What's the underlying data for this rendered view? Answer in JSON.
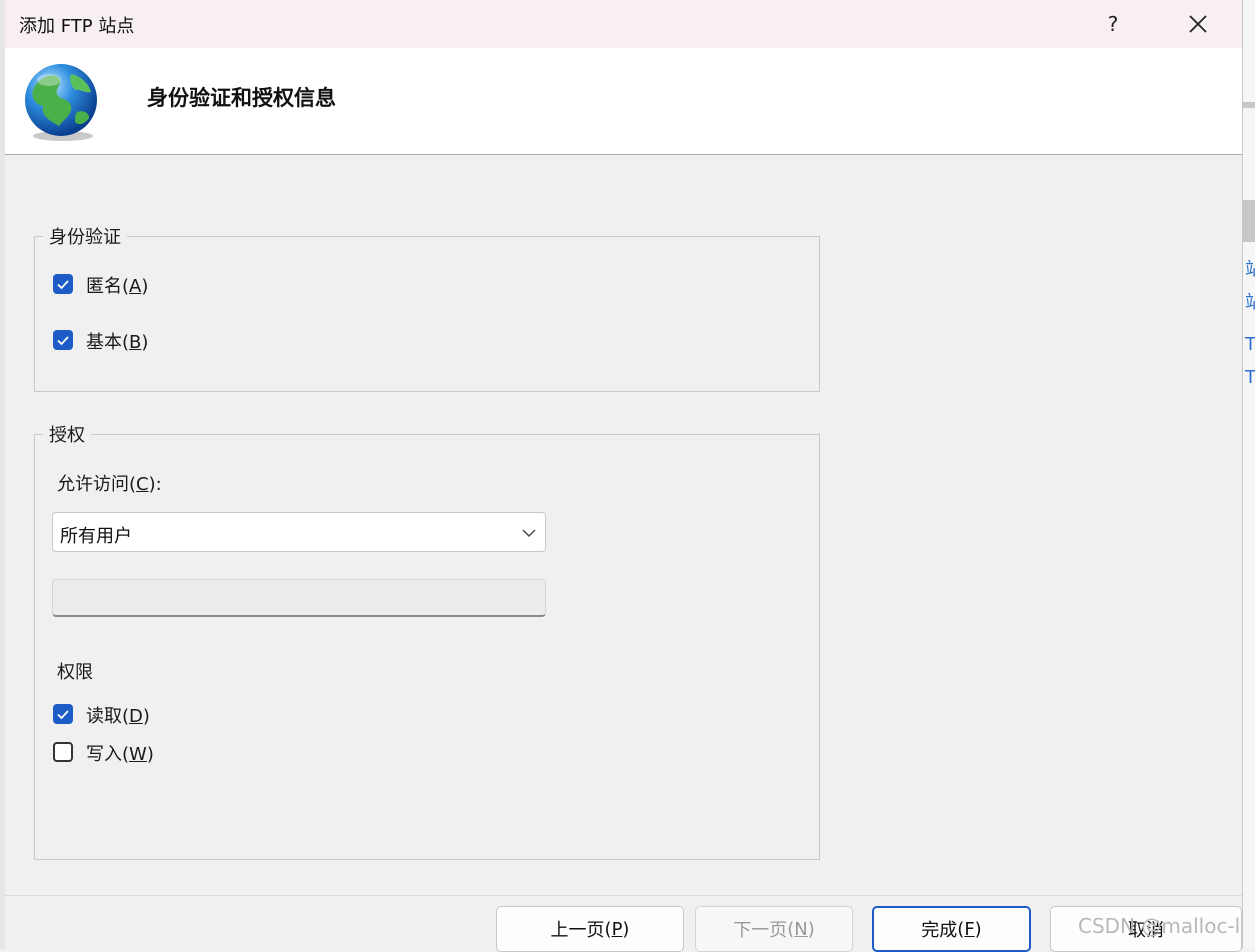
{
  "window": {
    "title": "添加 FTP 站点",
    "help_label": "?",
    "header_title": "身份验证和授权信息"
  },
  "authentication": {
    "legend": "身份验证",
    "anonymous": {
      "label": "匿名",
      "key": "A",
      "checked": true
    },
    "basic": {
      "label": "基本",
      "key": "B",
      "checked": true
    }
  },
  "authorization": {
    "legend": "授权",
    "allow_access": {
      "label": "允许访问",
      "key": "C",
      "suffix": ":",
      "selected": "所有用户"
    },
    "user_field_value": "",
    "permissions_label": "权限",
    "read": {
      "label": "读取",
      "key": "D",
      "checked": true
    },
    "write": {
      "label": "写入",
      "key": "W",
      "checked": false
    }
  },
  "buttons": {
    "previous": {
      "label": "上一页",
      "key": "P",
      "enabled": true
    },
    "next": {
      "label": "下一页",
      "key": "N",
      "enabled": false
    },
    "finish": {
      "label": "完成",
      "key": "F",
      "enabled": true
    },
    "cancel": {
      "label": "取消",
      "enabled": true
    }
  },
  "watermark": "CSDN @malloc-l",
  "background_window_fragments": [
    "站",
    "站",
    "T",
    "T"
  ],
  "colors": {
    "accent": "#1d5cc7",
    "titlebar": "#f7eff0",
    "link": "#2d6fd0"
  },
  "icons": {
    "header": "globe-icon",
    "help": "help-icon",
    "close": "close-icon",
    "dropdown": "chevron-down-icon"
  }
}
